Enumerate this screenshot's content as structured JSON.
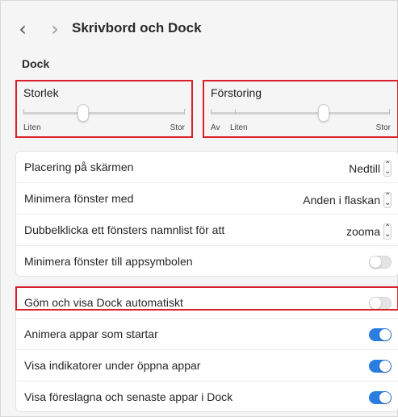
{
  "header": {
    "back_icon": "chevron-left-icon",
    "forward_icon": "chevron-right-icon",
    "title": "Skrivbord och Dock"
  },
  "section": {
    "title": "Dock"
  },
  "size_slider": {
    "title": "Storlek",
    "min_label": "Liten",
    "max_label": "Stor",
    "value_fraction": 0.37
  },
  "magnification_slider": {
    "title": "Förstoring",
    "off_label": "Av",
    "min_label": "Liten",
    "max_label": "Stor",
    "value_fraction": 0.63
  },
  "panel1": {
    "rows": [
      {
        "label": "Placering på skärmen",
        "value": "Nedtill"
      },
      {
        "label": "Minimera fönster med",
        "value": "Anden i flaskan"
      },
      {
        "label": "Dubbelklicka ett fönsters namnlist för att",
        "value": "zooma"
      },
      {
        "label": "Minimera fönster till appsymbolen",
        "toggle": false
      }
    ]
  },
  "panel2": {
    "rows": [
      {
        "label": "Göm och visa Dock automatiskt",
        "toggle": false
      },
      {
        "label": "Animera appar som startar",
        "toggle": true
      },
      {
        "label": "Visa indikatorer under öppna appar",
        "toggle": true
      },
      {
        "label": "Visa föreslagna och senaste appar i Dock",
        "toggle": true
      }
    ]
  },
  "colors": {
    "accent": "#2a7de1",
    "highlight": "#d6202a"
  }
}
